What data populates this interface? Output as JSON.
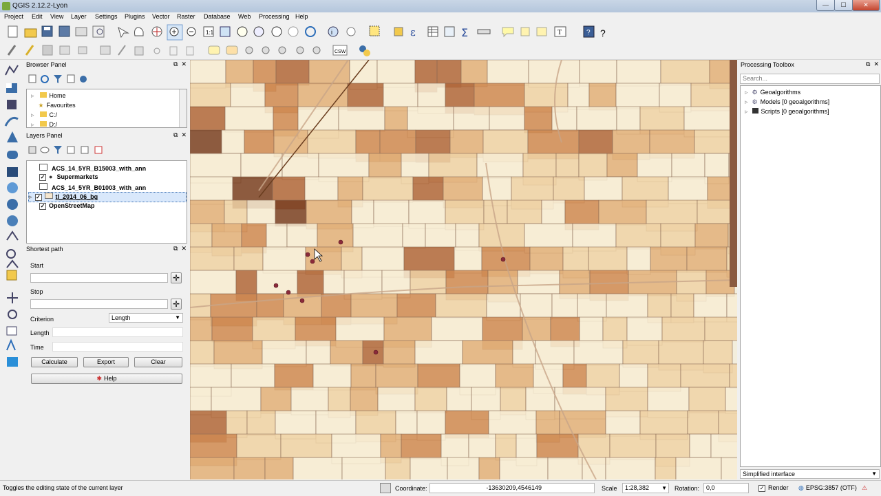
{
  "window": {
    "title": "QGIS 2.12.2-Lyon",
    "minimize": "—",
    "maximize": "☐",
    "close": "✕"
  },
  "menu": [
    "Project",
    "Edit",
    "View",
    "Layer",
    "Settings",
    "Plugins",
    "Vector",
    "Raster",
    "Database",
    "Web",
    "Processing",
    "Help"
  ],
  "browser_panel": {
    "title": "Browser Panel",
    "items": [
      "Home",
      "Favourites",
      "C:/",
      "D:/"
    ]
  },
  "layers_panel": {
    "title": "Layers Panel",
    "layers": [
      {
        "name": "ACS_14_5YR_B15003_with_ann",
        "checked": false
      },
      {
        "name": "Supermarkets",
        "checked": true
      },
      {
        "name": "ACS_14_5YR_B01003_with_ann",
        "checked": false
      },
      {
        "name": "tl_2014_06_bg",
        "checked": true
      },
      {
        "name": "OpenStreetMap",
        "checked": true
      }
    ]
  },
  "shortest_path": {
    "title": "Shortest path",
    "start_label": "Start",
    "stop_label": "Stop",
    "criterion_label": "Criterion",
    "criterion_value": "Length",
    "length_label": "Length",
    "time_label": "Time",
    "calculate": "Calculate",
    "export": "Export",
    "clear": "Clear",
    "help": "Help"
  },
  "processing_toolbox": {
    "title": "Processing Toolbox",
    "search_placeholder": "Search...",
    "items": [
      "Geoalgorithms",
      "Models [0 geoalgorithms]",
      "Scripts [0 geoalgorithms]"
    ],
    "footer": "Simplified interface"
  },
  "status": {
    "hint": "Toggles the editing state of the current layer",
    "coordinate_label": "Coordinate:",
    "coordinate_value": "-13630209,4546149",
    "scale_label": "Scale",
    "scale_value": "1:28,382",
    "rotation_label": "Rotation:",
    "rotation_value": "0,0",
    "render_label": "Render",
    "crs": "EPSG:3857 (OTF)"
  },
  "colors": {
    "choropleth": [
      "#f7ecd3",
      "#efd2a6",
      "#e2b07a",
      "#cf8a52",
      "#b0673b",
      "#7a4123"
    ],
    "supermarket_dot": "#8a2a3a"
  },
  "map_data": {
    "supermarket_count": 8
  }
}
